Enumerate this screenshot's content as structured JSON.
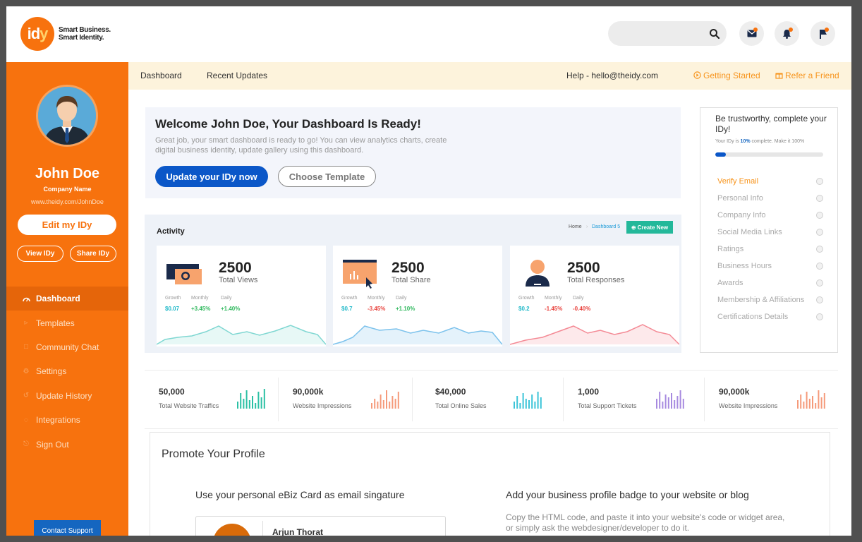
{
  "header": {
    "logo_text_a": "id",
    "logo_text_b": "y",
    "tagline_line1": "Smart Business.",
    "tagline_line2": "Smart Identity.",
    "search_placeholder": "",
    "icons": [
      "search-icon",
      "mail-icon",
      "bell-icon",
      "flag-icon"
    ]
  },
  "sidebar": {
    "user_name": "John Doe",
    "company": "Company Name",
    "url": "www.theidy.com/JohnDoe",
    "edit_label": "Edit my IDy",
    "view_label": "View IDy",
    "share_label": "Share IDy",
    "nav": [
      {
        "label": "Dashboard",
        "icon": "gauge-icon",
        "active": true
      },
      {
        "label": "Templates",
        "icon": "template-icon"
      },
      {
        "label": "Community Chat",
        "icon": "chat-icon"
      },
      {
        "label": "Settings",
        "icon": "gear-icon"
      },
      {
        "label": "Update History",
        "icon": "history-icon"
      },
      {
        "label": "Integrations",
        "icon": "integrations-icon"
      },
      {
        "label": "Sign Out",
        "icon": "power-icon"
      }
    ],
    "support_label": "Contact Support"
  },
  "subbar": {
    "dashboard": "Dashboard",
    "recent": "Recent Updates",
    "help": "Help - hello@theidy.com",
    "getting_started": "Getting Started",
    "refer": "Refer a Friend"
  },
  "welcome": {
    "title": "Welcome John Doe, Your Dashboard Is Ready!",
    "text": "Great job, your smart dashboard is ready to go! You can view analytics charts, create digital business identity, update gallery using this dashboard.",
    "primary_btn": "Update your IDy now",
    "secondary_btn": "Choose Template"
  },
  "activity": {
    "title": "Activity",
    "crumb_home": "Home",
    "crumb_current": "Dashboard 5",
    "create_label": "Create New",
    "metric_headers": [
      "Growth",
      "Monthly",
      "Daily"
    ],
    "cards": [
      {
        "value": "2500",
        "label": "Total Views",
        "metrics": [
          "$0.07",
          "+3.45%",
          "+1.40%"
        ],
        "metric_colors": [
          "#1db8c8",
          "#2eb85c",
          "#2eb85c"
        ],
        "color": "#7fd7d2",
        "fill": "#e7f8f6"
      },
      {
        "value": "2500",
        "label": "Total Share",
        "metrics": [
          "$0.7",
          "-3.45%",
          "+1.10%"
        ],
        "metric_colors": [
          "#1db8c8",
          "#e8413c",
          "#2eb85c"
        ],
        "color": "#7cc2ec",
        "fill": "#e4f2fb"
      },
      {
        "value": "2500",
        "label": "Total Responses",
        "metrics": [
          "$0.2",
          "-1.45%",
          "-0.40%"
        ],
        "metric_colors": [
          "#1db8c8",
          "#e8413c",
          "#e8413c"
        ],
        "color": "#f48a95",
        "fill": "#fde9eb"
      }
    ]
  },
  "profile": {
    "title": "Be trustworthy, complete your IDy!",
    "note_prefix": "Your IDy is ",
    "note_pct": "10%",
    "note_suffix": " complete. Make it 100%",
    "progress": 0.1,
    "items": [
      "Verify Email",
      "Personal Info",
      "Company Info",
      "Social Media Links",
      "Ratings",
      "Business Hours",
      "Awards",
      "Membership & Affiliations",
      "Certifications Details"
    ]
  },
  "stats": [
    {
      "value": "50,000",
      "label": "Total Website Traffics",
      "color": "#2bc0a4"
    },
    {
      "value": "90,000k",
      "label": "Website Impressions",
      "color": "#f59a7a"
    },
    {
      "value": "$40,000",
      "label": "Total Online Sales",
      "color": "#3cc4d8"
    },
    {
      "value": "1,000",
      "label": "Total Support Tickets",
      "color": "#a78ae0"
    },
    {
      "value": "90,000k",
      "label": "Website Impressions",
      "color": "#f59a7a"
    }
  ],
  "promote": {
    "title": "Promote Your Profile",
    "left_heading": "Use your personal eBiz Card as email singature",
    "right_heading": "Add your business profile badge to your website or blog",
    "right_text": "Copy the HTML code, and paste it into your website's code or widget area, or simply ask the webdesigner/developer to do it.",
    "card_name": "Arjun Thorat"
  }
}
